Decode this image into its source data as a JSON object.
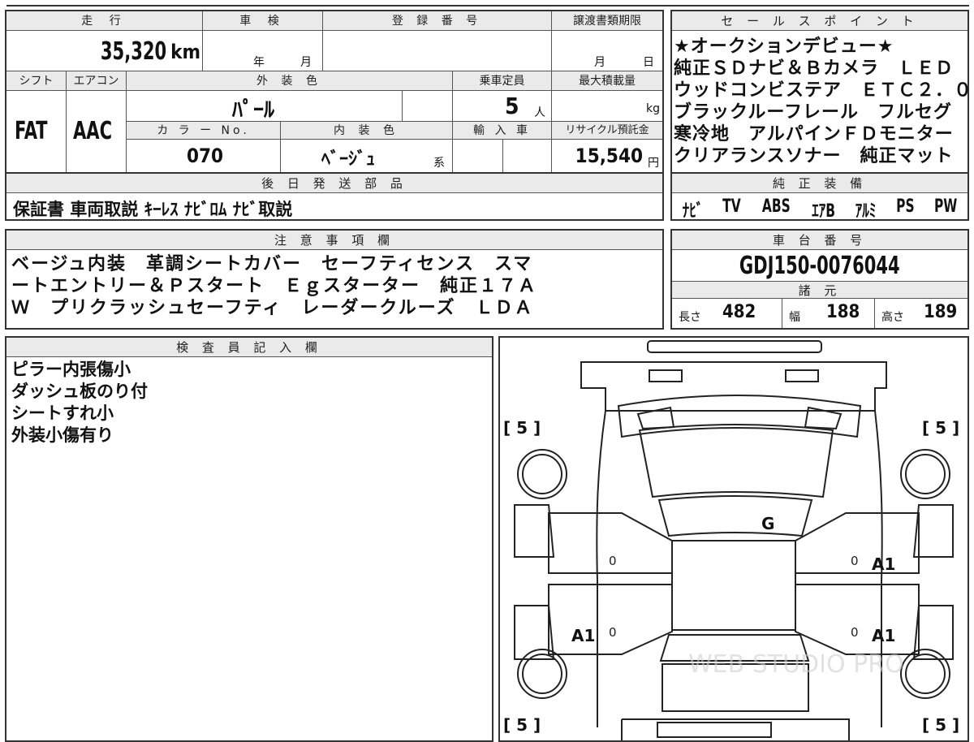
{
  "summary": {
    "mileage_label": "走 行",
    "mileage_value": "35,320",
    "mileage_unit": "km",
    "inspection_label": "車 検",
    "inspection_year_unit": "年",
    "inspection_month_unit": "月",
    "registration_label": "登 録 番 号",
    "transfer_label": "譲渡書類期限",
    "transfer_month_unit": "月",
    "transfer_day_unit": "日",
    "shift_label": "シフト",
    "shift_value": "FAT",
    "ac_label": "エアコン",
    "ac_value": "AAC",
    "exterior_color_label": "外 装 色",
    "exterior_color_value": "ﾊﾟｰﾙ",
    "capacity_label": "乗車定員",
    "capacity_value": "5",
    "capacity_unit": "人",
    "max_load_label": "最大積載量",
    "max_load_unit": "kg",
    "color_no_label": "カ ラ ー No.",
    "color_no_value": "070",
    "interior_color_label": "内 装 色",
    "interior_color_value": "ﾍﾞｰｼﾞｭ",
    "interior_color_suffix": "系",
    "import_label": "輸 入 車",
    "recycle_label": "リサイクル預託金",
    "recycle_value": "15,540",
    "recycle_unit": "円"
  },
  "delivery_parts": {
    "header": "後 日 発 送 部 品",
    "text": "保証書 車両取説 ｷｰﾚｽ ﾅﾋﾞﾛﾑ ﾅﾋﾞ取説"
  },
  "sales_points": {
    "header": "セ ー ル ス ポ イ ン ト",
    "lines": [
      "★オークションデビュー★",
      "純正ＳＤナビ＆Ｂカメラ　ＬＥＤ",
      "ウッドコンビステア　ＥＴＣ２．０",
      "ブラックルーフレール　フルセグ",
      "寒冷地　アルパインＦＤモニター",
      "クリアランスソナー　純正マット"
    ]
  },
  "genuine_equipment": {
    "header": "純 正 装 備",
    "items": [
      "ﾅﾋﾞ",
      "TV",
      "ABS",
      "ｴｱB",
      "ｱﾙﾐ",
      "PS",
      "PW"
    ]
  },
  "notes": {
    "header": "注 意 事 項 欄",
    "lines": [
      "ベージュ内装　革調シートカバー　セーフティセンス　スマ",
      "ートエントリー＆Ｐスタート　Ｅｇスターター　純正１７Ａ",
      "Ｗ　プリクラッシュセーフティ　レーダークルーズ　ＬＤＡ"
    ]
  },
  "chassis": {
    "header": "車 台 番 号",
    "value": "GDJ150-0076044"
  },
  "dimensions": {
    "header": "諸 元",
    "length_label": "長さ",
    "length_value": "482",
    "width_label": "幅",
    "width_value": "188",
    "height_label": "高さ",
    "height_value": "189"
  },
  "inspector": {
    "header": "検 査 員 記 入 欄",
    "lines": [
      "ピラー内張傷小",
      "ダッシュ板のり付",
      "シートすれ小",
      "外装小傷有り"
    ]
  },
  "diagram": {
    "tire_fl": "[ 5 ]",
    "tire_fr": "[ 5 ]",
    "tire_rl": "[ 5 ]",
    "tire_rr": "[ 5 ]",
    "windshield_mark": "G",
    "front_right_door_mark": "A1",
    "rear_left_door_mark": "A1",
    "rear_right_door_mark": "A1",
    "zero_mark": "0",
    "watermark": "WEB STUDIO PRO"
  }
}
